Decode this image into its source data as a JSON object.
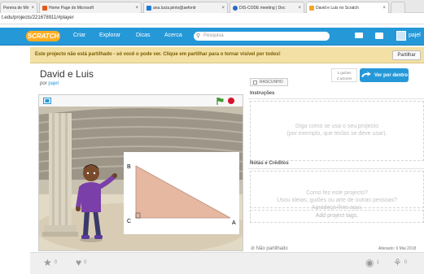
{
  "browser": {
    "tabs": [
      {
        "label": "Pereira de Mir"
      },
      {
        "label": "Home Page do Microsoft"
      },
      {
        "label": "ana.lucia.pinto@aefontr"
      },
      {
        "label": "DIS-CODE meeting | Doc"
      },
      {
        "label": "David e Luis no Scratch"
      }
    ],
    "url": "t.edu/projects/221678911/#player"
  },
  "nav": {
    "logo": "SCRATCH",
    "create": "Criar",
    "explore": "Explorar",
    "tips": "Dicas",
    "about": "Acerca",
    "search_placeholder": "Pesquisa",
    "username": "pajel"
  },
  "banner": {
    "message": "Este projecto não está partilhado - só você o pode ver. Clique em partilhar para o tornar visível por todos!",
    "share_label": "Partilhar"
  },
  "project": {
    "title": "David e Luis",
    "by": "por",
    "author": "pajel",
    "draft_label": "RASCUNHO",
    "stats_line1": "1 guiões",
    "stats_line2": "2 actores",
    "see_inside_label": "Ver por dentro"
  },
  "stage": {
    "vertex_b": "B",
    "vertex_c": "C",
    "vertex_a": "A"
  },
  "instructions": {
    "heading": "Instruções",
    "placeholder_line1": "Diga como se usa o seu projecto",
    "placeholder_line2": "(por exemplo, que teclas se deve usar)."
  },
  "notes": {
    "heading": "Notas e Créditos",
    "placeholder_line1": "Como fez este projecto?",
    "placeholder_line2": "Usou ideias, guiões ou arte de outras pessoas?",
    "placeholder_line3": "Agradeça-lhes aqui."
  },
  "tags_placeholder": "Add project tags.",
  "footer": {
    "not_shared": "Não partilhado",
    "altered": "Alterado: 9 Mai 2018",
    "love_count": "0",
    "fav_count": "0",
    "views_count": "1",
    "remix_count": "0"
  },
  "colors": {
    "scratch_blue": "#2598d8",
    "logo_orange": "#ffad1f",
    "banner_bg": "#f2e0a5",
    "stop_red": "#d8112d",
    "flag_green": "#3c9a2c"
  }
}
